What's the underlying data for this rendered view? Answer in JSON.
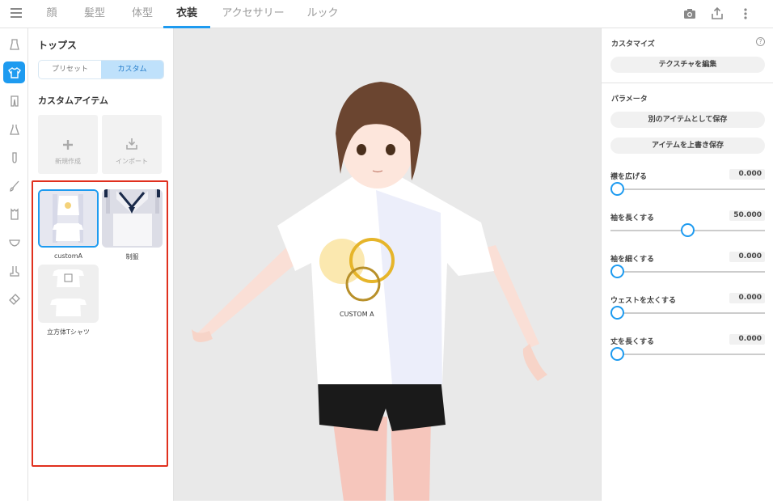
{
  "topbar": {
    "tabs": [
      {
        "label": "顔"
      },
      {
        "label": "髪型"
      },
      {
        "label": "体型"
      },
      {
        "label": "衣装"
      },
      {
        "label": "アクセサリー"
      },
      {
        "label": "ルック"
      }
    ],
    "active_tab": "衣装",
    "icons": [
      "camera-icon",
      "share-icon",
      "more-vertical-icon"
    ]
  },
  "rail": {
    "icons": [
      "hat-icon",
      "tops-icon",
      "pants-icon",
      "dress-icon",
      "socks-icon",
      "brush-icon",
      "jacket-icon",
      "underwear-icon",
      "boots-icon",
      "eraser-icon"
    ],
    "active_index": 1
  },
  "left_panel": {
    "title": "トップス",
    "segments": [
      {
        "label": "プリセット"
      },
      {
        "label": "カスタム"
      }
    ],
    "active_segment": "カスタム",
    "section_title": "カスタムアイテム",
    "actions": [
      {
        "label": "新規作成",
        "icon": "plus-icon"
      },
      {
        "label": "インポート",
        "icon": "import-icon"
      }
    ],
    "items": [
      {
        "name": "customA",
        "selected": true
      },
      {
        "name": "制服",
        "selected": false
      },
      {
        "name": "立方体Tシャツ",
        "selected": false
      }
    ]
  },
  "viewport": {
    "shirt_print_text": "CUSTOM A"
  },
  "right_panel": {
    "customize_heading": "カスタマイズ",
    "edit_texture_label": "テクスチャを編集",
    "params_heading": "パラメータ",
    "save_as_new_label": "別のアイテムとして保存",
    "overwrite_label": "アイテムを上書き保存",
    "params": [
      {
        "label": "襟を広げる",
        "value": "0.000",
        "fraction": 0.0
      },
      {
        "label": "袖を長くする",
        "value": "50.000",
        "fraction": 0.5
      },
      {
        "label": "袖を細くする",
        "value": "0.000",
        "fraction": 0.0
      },
      {
        "label": "ウェストを太くする",
        "value": "0.000",
        "fraction": 0.0
      },
      {
        "label": "丈を長くする",
        "value": "0.000",
        "fraction": 0.0
      }
    ]
  },
  "colors": {
    "accent": "#1e9bf0",
    "highlight": "#e0301e"
  }
}
